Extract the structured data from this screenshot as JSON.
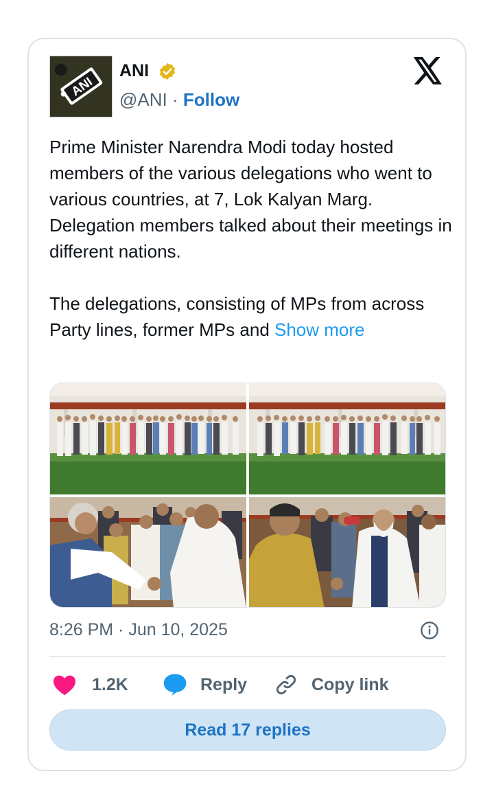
{
  "tweet": {
    "author_name": "ANI",
    "handle": "@ANI",
    "separator": " · ",
    "follow_label": "Follow",
    "avatar_text": "ANI",
    "text_paragraph_1": "Prime Minister Narendra Modi today hosted members of the various delegations who went to various countries, at 7, Lok Kalyan Marg. Delegation members talked about their meetings in different nations.",
    "text_paragraph_2": "The delegations, consisting of MPs from across Party lines, former MPs and ",
    "show_more_label": "Show more",
    "timestamp": "8:26 PM · Jun 10, 2025",
    "likes": "1.2K",
    "reply_label": "Reply",
    "copy_link_label": "Copy link",
    "read_replies_label": "Read 17 replies"
  },
  "icons": {
    "verified": "verified-badge-icon",
    "x_logo": "x-logo-icon",
    "info": "info-icon",
    "like": "heart-icon",
    "reply": "speech-bubble-icon",
    "copy": "link-icon"
  },
  "colors": {
    "link": "#1d74c4",
    "show_more": "#1d9bf0",
    "heart": "#f91880",
    "reply_bubble": "#1d9bf0",
    "verified_gold": "#e2b719",
    "button_bg": "#cfe4f5"
  }
}
